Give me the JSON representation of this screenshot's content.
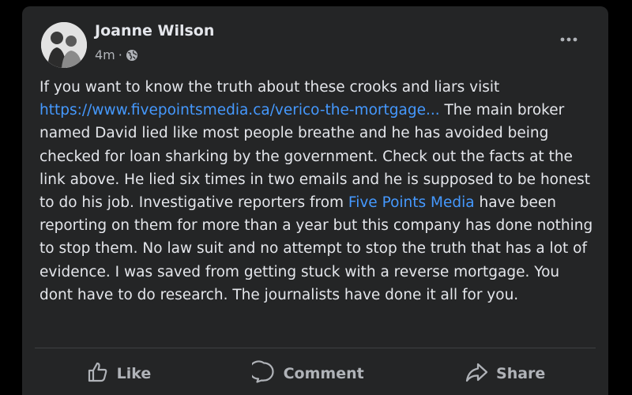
{
  "post": {
    "author": "Joanne Wilson",
    "time": "4m",
    "separator": "·",
    "audience_icon": "globe-icon",
    "more_icon": "more-options-icon",
    "text_parts": {
      "part1": "If you want to know the truth about these crooks and liars visit ",
      "link1": "https://www.fivepointsmedia.ca/verico-the-mortgage...",
      "part2": " The main broker named David lied like most people breathe and he has avoided being checked for loan sharking by the government. Check out the facts at the link above. He lied six times in two emails and he is supposed to be honest to do his job. Investigative reporters from ",
      "link2": "Five Points Media",
      "part3": " have been reporting on them for more than a year but this company has done nothing to stop them. No law suit and no attempt to stop the truth that has a lot of evidence. I was saved from getting stuck with a reverse mortgage. You dont have to do research. The journalists have done it all for you."
    }
  },
  "actions": {
    "like": {
      "label": "Like",
      "icon": "thumbs-up-icon"
    },
    "comment": {
      "label": "Comment",
      "icon": "comment-bubble-icon"
    },
    "share": {
      "label": "Share",
      "icon": "share-arrow-icon"
    }
  },
  "colors": {
    "background": "#000000",
    "card": "#242526",
    "primary_text": "#e4e6eb",
    "secondary_text": "#b0b3b8",
    "link": "#4599ff"
  }
}
